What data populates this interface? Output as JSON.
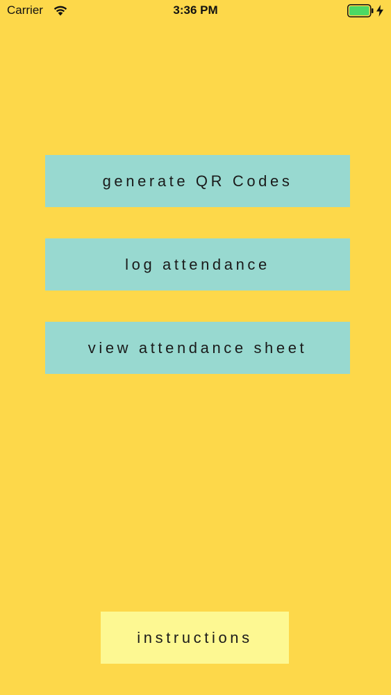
{
  "status_bar": {
    "carrier": "Carrier",
    "time": "3:36 PM",
    "icons": [
      "wifi-icon",
      "battery-icon",
      "charge-icon"
    ],
    "battery_color": "#4CD964"
  },
  "menu": {
    "generate_qr_label": "generate QR Codes",
    "log_attendance_label": "log attendance",
    "view_sheet_label": "view attendance sheet"
  },
  "footer": {
    "instructions_label": "instructions"
  },
  "colors": {
    "background": "#FDD84A",
    "menu_button": "#98D9D0",
    "instructions_button": "#FDF892"
  }
}
